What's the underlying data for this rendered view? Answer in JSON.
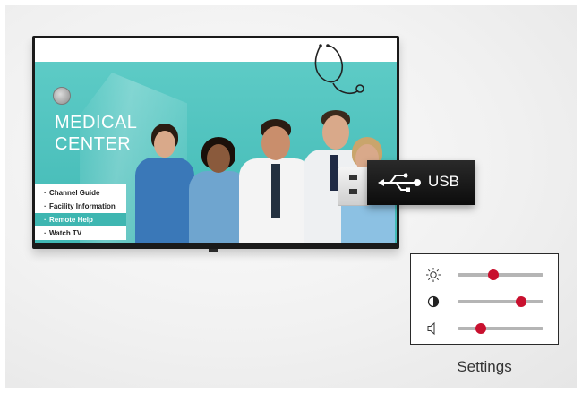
{
  "screen": {
    "title_line1": "MEDICAL",
    "title_line2": "CENTER",
    "menu": [
      {
        "label": "Channel Guide",
        "active": false
      },
      {
        "label": "Facility Information",
        "active": false
      },
      {
        "label": "Remote Help",
        "active": true
      },
      {
        "label": "Watch TV",
        "active": false
      }
    ],
    "menu_bullet": "·"
  },
  "usb": {
    "label": "USB",
    "icon": "usb-icon"
  },
  "settings": {
    "caption": "Settings",
    "rows": [
      {
        "name": "brightness",
        "icon": "brightness-icon",
        "level": 0.42
      },
      {
        "name": "contrast",
        "icon": "contrast-icon",
        "level": 0.74
      },
      {
        "name": "volume",
        "icon": "speaker-icon",
        "level": 0.27
      }
    ],
    "accent_color": "#c8102e"
  }
}
